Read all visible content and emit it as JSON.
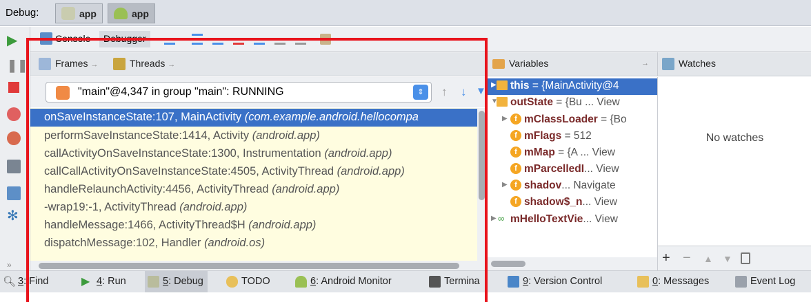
{
  "debug_bar": {
    "label": "Debug:",
    "tabs": [
      {
        "label": "app"
      },
      {
        "label": "app"
      }
    ]
  },
  "toolbar": {
    "console_label": "Console",
    "debugger_label": "Debugger"
  },
  "frames_panel": {
    "frames_tab": "Frames",
    "threads_tab": "Threads",
    "thread_selector": "\"main\"@4,347 in group \"main\": RUNNING",
    "frames": [
      {
        "method": "onSaveInstanceState:107, MainActivity ",
        "pkg": "(com.example.android.hellocompa"
      },
      {
        "method": "performSaveInstanceState:1414, Activity ",
        "pkg": "(android.app)"
      },
      {
        "method": "callActivityOnSaveInstanceState:1300, Instrumentation ",
        "pkg": "(android.app)"
      },
      {
        "method": "callCallActivityOnSaveInstanceState:4505, ActivityThread ",
        "pkg": "(android.app)"
      },
      {
        "method": "handleRelaunchActivity:4456, ActivityThread ",
        "pkg": "(android.app)"
      },
      {
        "method": "-wrap19:-1, ActivityThread ",
        "pkg": "(android.app)"
      },
      {
        "method": "handleMessage:1466, ActivityThread$H ",
        "pkg": "(android.app)"
      },
      {
        "method": "dispatchMessage:102, Handler ",
        "pkg": "(android.os)"
      }
    ]
  },
  "variables_panel": {
    "title": "Variables",
    "items": [
      {
        "name": "this",
        "value": " = {MainActivity@4"
      },
      {
        "name": "outState",
        "value": " = {Bu ... View"
      },
      {
        "name": "mClassLoader",
        "value": " = {Bo"
      },
      {
        "name": "mFlags",
        "value": " = 512"
      },
      {
        "name": "mMap",
        "value": " = {A ... View"
      },
      {
        "name": "mParcelledI",
        "value": "... View"
      },
      {
        "name": "shadov",
        "value": "... Navigate"
      },
      {
        "name": "shadow$_n",
        "value": "... View"
      },
      {
        "name": "mHelloTextVie",
        "value": "... View"
      }
    ]
  },
  "watches_panel": {
    "title": "Watches",
    "empty_text": "No watches"
  },
  "bottom_bar": {
    "items": [
      {
        "key": "3",
        "label": ": Find"
      },
      {
        "key": "4",
        "label": ": Run"
      },
      {
        "key": "5",
        "label": ": Debug"
      },
      {
        "key": "",
        "label": "TODO"
      },
      {
        "key": "6",
        "label": ": Android Monitor"
      },
      {
        "key": "",
        "label": "Termina"
      },
      {
        "key": "9",
        "label": ": Version Control"
      },
      {
        "key": "0",
        "label": ": Messages"
      },
      {
        "key": "",
        "label": "Event Log"
      }
    ]
  },
  "colors": {
    "highlight": "#e8141c",
    "selection": "#3a71c7",
    "frame_bg": "#fffde0"
  }
}
